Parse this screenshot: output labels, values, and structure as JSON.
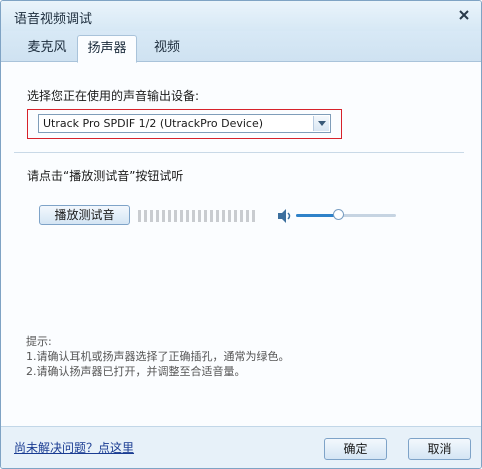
{
  "window": {
    "title": "语音视频调试"
  },
  "tabs": [
    {
      "label": "麦克风"
    },
    {
      "label": "扬声器"
    },
    {
      "label": "视频"
    }
  ],
  "active_tab": "扬声器",
  "speaker": {
    "device_prompt": "选择您正在使用的声音输出设备:",
    "device_selected": "Utrack Pro SPDIF 1/2 (UtrackPro Device)",
    "test_instruction": "请点击“播放测试音”按钮试听",
    "play_button_label": "播放测试音",
    "volume_level": 0.42
  },
  "tips": {
    "header": "提示:",
    "lines": [
      "1.请确认耳机或扬声器选择了正确插孔，通常为绿色。",
      "2.请确认扬声器已打开，并调整至合适音量。"
    ]
  },
  "footer": {
    "help_link": "尚未解决问题？点这里",
    "ok_label": "确定",
    "cancel_label": "取消"
  },
  "colors": {
    "highlight_border": "#d7232b",
    "slider_fill": "#2f82c9",
    "link": "#1a3c92"
  },
  "icons": {
    "close": "close-icon",
    "dropdown": "chevron-down-icon",
    "speaker": "speaker-icon"
  }
}
